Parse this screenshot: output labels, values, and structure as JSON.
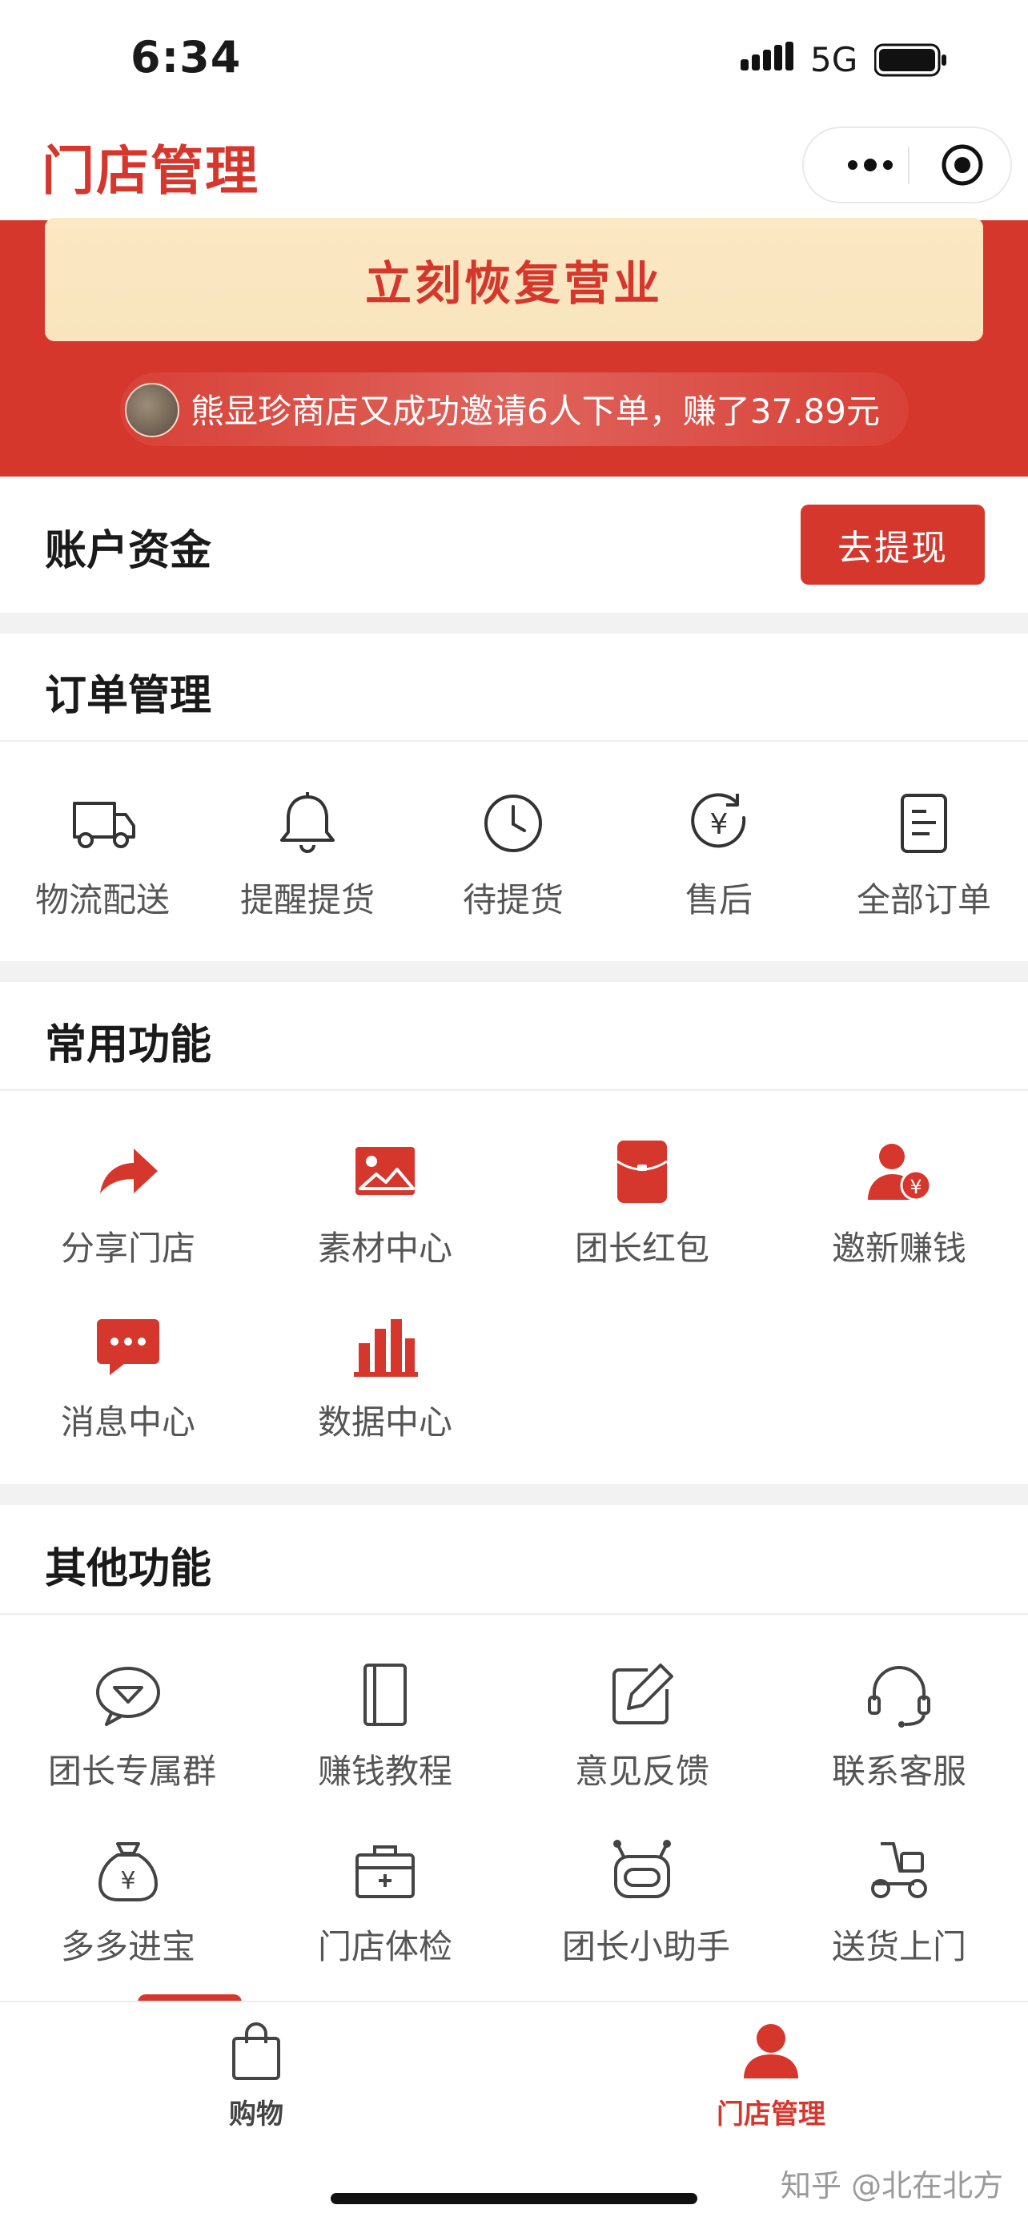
{
  "status_bar": {
    "time": "6:34",
    "network": "5G"
  },
  "nav": {
    "title": "门店管理"
  },
  "banner": {
    "resume_label": "立刻恢复营业",
    "notice": "熊显珍商店又成功邀请6人下单，赚了37.89元"
  },
  "account": {
    "title": "账户资金",
    "withdraw_label": "去提现"
  },
  "orders": {
    "title": "订单管理",
    "items": [
      {
        "label": "物流配送",
        "icon": "truck-icon"
      },
      {
        "label": "提醒提货",
        "icon": "bell-icon"
      },
      {
        "label": "待提货",
        "icon": "clock-icon"
      },
      {
        "label": "售后",
        "icon": "refund-icon"
      },
      {
        "label": "全部订单",
        "icon": "order-list-icon"
      }
    ]
  },
  "common": {
    "title": "常用功能",
    "items": [
      {
        "label": "分享门店",
        "icon": "share-arrow-icon"
      },
      {
        "label": "素材中心",
        "icon": "image-icon"
      },
      {
        "label": "团长红包",
        "icon": "red-envelope-icon"
      },
      {
        "label": "邀新赚钱",
        "icon": "invite-user-money-icon"
      },
      {
        "label": "消息中心",
        "icon": "message-bubble-icon"
      },
      {
        "label": "数据中心",
        "icon": "bar-chart-icon"
      }
    ]
  },
  "other": {
    "title": "其他功能",
    "items": [
      {
        "label": "团长专属群",
        "icon": "group-chat-icon"
      },
      {
        "label": "赚钱教程",
        "icon": "book-icon"
      },
      {
        "label": "意见反馈",
        "icon": "edit-icon"
      },
      {
        "label": "联系客服",
        "icon": "headset-icon"
      },
      {
        "label": "多多进宝",
        "icon": "money-bag-icon"
      },
      {
        "label": "门店体检",
        "icon": "medical-kit-icon"
      },
      {
        "label": "团长小助手",
        "icon": "robot-icon"
      },
      {
        "label": "送货上门",
        "icon": "scooter-icon"
      }
    ]
  },
  "tab_bar": {
    "items": [
      {
        "label": "购物",
        "icon": "shopping-bag-icon",
        "active": false
      },
      {
        "label": "门店管理",
        "icon": "user-icon",
        "active": true
      }
    ]
  },
  "watermark": "知乎 @北在北方",
  "colors": {
    "brand_red": "#d6372d",
    "banner_button": "#fbe8c4",
    "active_tab": "#d6372d"
  }
}
